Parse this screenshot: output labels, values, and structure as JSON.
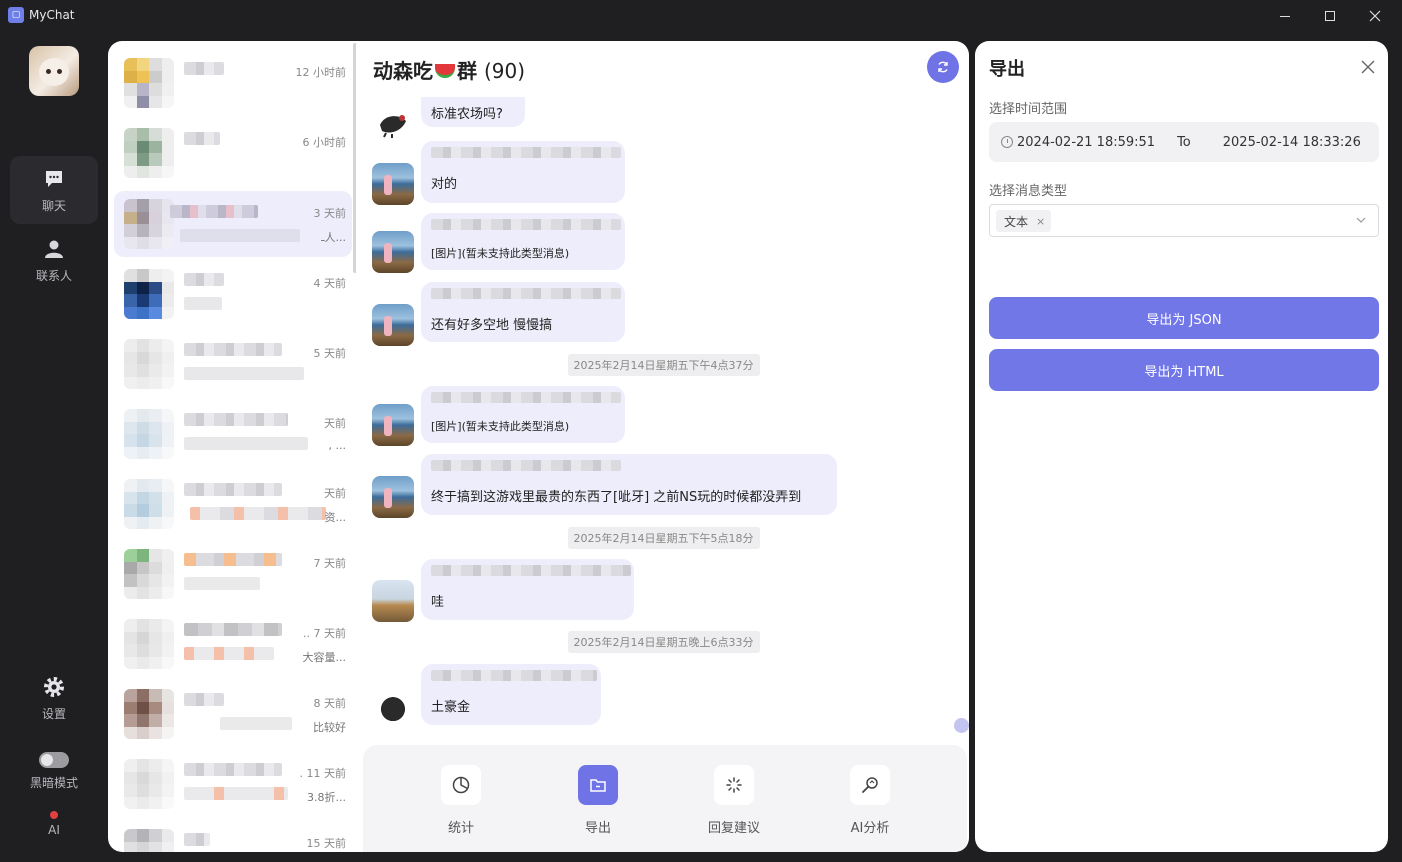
{
  "window": {
    "title": "MyChat",
    "icon_name": "mychat-logo-icon"
  },
  "nav": {
    "items": [
      {
        "label": "聊天",
        "icon": "chat-bubble-icon"
      },
      {
        "label": "联系人",
        "icon": "person-icon"
      },
      {
        "label": "设置",
        "icon": "gear-icon"
      },
      {
        "label": "黑暗模式",
        "icon": "toggle-switch"
      },
      {
        "label": "AI",
        "icon": "red-dot-indicator"
      }
    ]
  },
  "conversations": [
    {
      "time": "12 小时前",
      "sub": ""
    },
    {
      "time": "6 小时前",
      "sub": ""
    },
    {
      "time": "3 天前",
      "sub": "ـ人..."
    },
    {
      "time": "4 天前",
      "sub": ""
    },
    {
      "time": "5 天前",
      "sub": ""
    },
    {
      "time": "天前",
      "sub": ", ..."
    },
    {
      "time": "天前",
      "sub": "资..."
    },
    {
      "time": "7 天前",
      "sub": ""
    },
    {
      "time": ".. 7 天前",
      "sub": "大容量..."
    },
    {
      "time": "8 天前",
      "sub": "比较好"
    },
    {
      "time": ". 11 天前",
      "sub": "3.8折..."
    },
    {
      "time": "15 天前",
      "sub": ""
    }
  ],
  "chat": {
    "name": "动森吃",
    "name_suffix": "群",
    "member_count": "(90)",
    "messages": [
      {
        "text": "标准农场吗?"
      },
      {
        "text": "对的"
      },
      {
        "text": "[图片](暂未支持此类型消息)"
      },
      {
        "text": "还有好多空地 慢慢搞"
      },
      {
        "text": "[图片](暂未支持此类型消息)"
      },
      {
        "text": "终于搞到这游戏里最贵的东西了[呲牙] 之前NS玩的时候都没弄到"
      },
      {
        "text": "哇"
      },
      {
        "text": "土豪金"
      }
    ],
    "time_separators": [
      "2025年2月14日星期五下午4点37分",
      "2025年2月14日星期五下午5点18分",
      "2025年2月14日星期五晚上6点33分"
    ]
  },
  "toolbar": {
    "tools": [
      {
        "label": "统计",
        "icon": "pie-chart-icon"
      },
      {
        "label": "导出",
        "icon": "export-folder-icon"
      },
      {
        "label": "回复建议",
        "icon": "sparkle-icon"
      },
      {
        "label": "AI分析",
        "icon": "magnifier-icon"
      }
    ]
  },
  "export_panel": {
    "title": "导出",
    "time_range_label": "选择时间范围",
    "start": "2024-02-21 18:59:51",
    "to": "To",
    "end": "2025-02-14 18:33:26",
    "type_label": "选择消息类型",
    "selected_type": "文本",
    "tag_remove": "×",
    "buttons": {
      "json": "导出为 JSON",
      "html": "导出为 HTML"
    }
  },
  "colors": {
    "accent": "#7277e8",
    "bubble": "#eeedfb",
    "dark_bg": "#1f1f22"
  }
}
